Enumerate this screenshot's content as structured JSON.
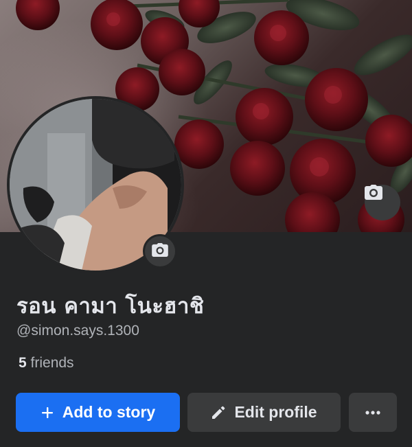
{
  "profile": {
    "name": "รอน คามา โนะฮาชิ",
    "username": "@simon.says.1300",
    "friends": {
      "count": "5",
      "label": "friends"
    }
  },
  "actions": {
    "add_to_story": "Add to story",
    "edit_profile": "Edit profile",
    "more": "more-horizontal-icon"
  },
  "icons": {
    "cover_camera": "camera-icon",
    "avatar_camera": "camera-icon",
    "add": "plus-icon",
    "edit": "pencil-icon"
  },
  "colors": {
    "background": "#242526",
    "primary_button": "#1b6ff2",
    "secondary_button": "#3a3b3c",
    "text_primary": "#e4e6eb",
    "text_secondary": "#b0b3b8"
  }
}
